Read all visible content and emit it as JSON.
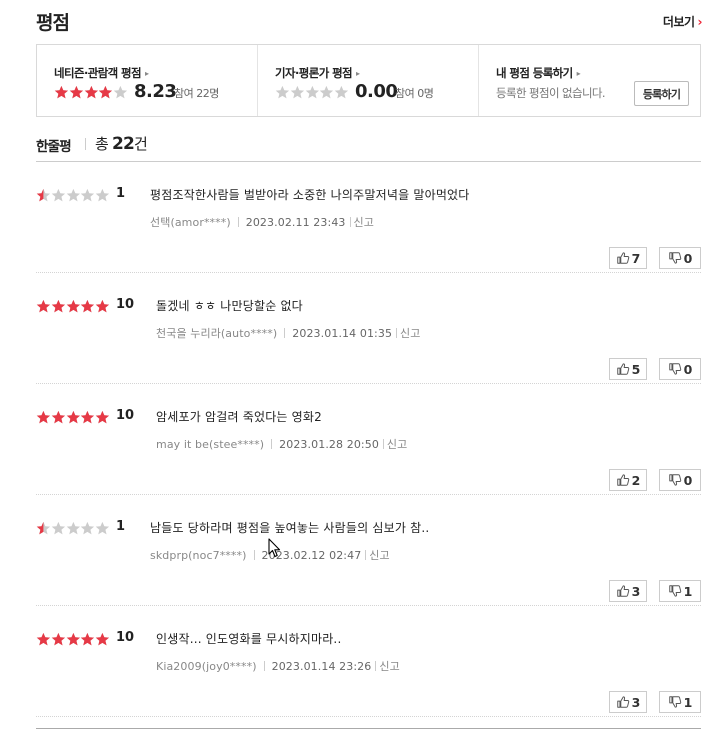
{
  "header": {
    "title": "평점",
    "more_label": "더보기",
    "more_chevron": "›"
  },
  "summary": {
    "audience": {
      "label": "네티즌·관람객 평점",
      "rating_stars": 4,
      "score": "8.23",
      "count": "참여 22명"
    },
    "critics": {
      "label": "기자·평론가 평점",
      "rating_stars": 0,
      "score": "0.00",
      "count": "참여 0명"
    },
    "mine": {
      "label": "내 평점 등록하기",
      "message": "등록한 평점이 없습니다.",
      "button_label": "등록하기"
    },
    "arrow": "▸"
  },
  "section": {
    "title": "한줄평",
    "total_prefix": "총",
    "total_count": "22",
    "total_suffix": "건"
  },
  "reviews": [
    {
      "stars": 0.5,
      "score": "1",
      "text": "평점조작한사람들 벌받아라 소중한 나의주말저녁을 말아먹었다",
      "author": "선택(amor****)",
      "date": "2023.02.11 23:43",
      "report": "신고",
      "likes": "7",
      "dislikes": "0"
    },
    {
      "stars": 5,
      "score": "10",
      "text": "돌겠네 ㅎㅎ 나만당할순 없다",
      "author": "천국을 누리라(auto****)",
      "date": "2023.01.14 01:35",
      "report": "신고",
      "likes": "5",
      "dislikes": "0"
    },
    {
      "stars": 5,
      "score": "10",
      "text": "암세포가 암걸려 죽었다는 영화2",
      "author": "may it be(stee****)",
      "date": "2023.01.28 20:50",
      "report": "신고",
      "likes": "2",
      "dislikes": "0"
    },
    {
      "stars": 0.5,
      "score": "1",
      "text": "남들도 당하라며 평점을 높여놓는 사람들의 심보가 참..",
      "author": "skdprp(noc7****)",
      "date": "2023.02.12 02:47",
      "report": "신고",
      "likes": "3",
      "dislikes": "1"
    },
    {
      "stars": 5,
      "score": "10",
      "text": "인생작... 인도영화를 무시하지마라..",
      "author": "Kia2009(joy0****)",
      "date": "2023.01.14 23:26",
      "report": "신고",
      "likes": "3",
      "dislikes": "1"
    }
  ],
  "colors": {
    "star_filled": "#e63946",
    "star_empty": "#cccccc",
    "accent": "#e22233"
  },
  "icons": {
    "thumb_up": "thumb-up-icon",
    "thumb_down": "thumb-down-icon",
    "star": "star-icon",
    "cursor": "mouse-cursor-icon"
  }
}
